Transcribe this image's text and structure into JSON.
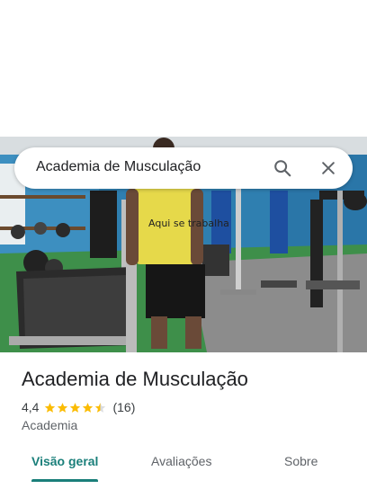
{
  "search": {
    "query": "Academia de Musculação",
    "icon": "search-icon",
    "close_icon": "close-icon"
  },
  "photo": {
    "shirt_text": "Aqui se trabalha",
    "description_icon": "place-photo"
  },
  "place": {
    "title": "Academia de Musculação",
    "rating": "4,4",
    "rating_value": 4.4,
    "review_count": "(16)",
    "category": "Academia"
  },
  "tabs": [
    {
      "label": "Visão geral",
      "active": true
    },
    {
      "label": "Avaliações",
      "active": false
    },
    {
      "label": "Sobre",
      "active": false
    }
  ],
  "colors": {
    "accent": "#1a7f7a",
    "star": "#fbbc04",
    "gym_wall": "#2f7fb0",
    "floor": "#3e8f4a"
  }
}
